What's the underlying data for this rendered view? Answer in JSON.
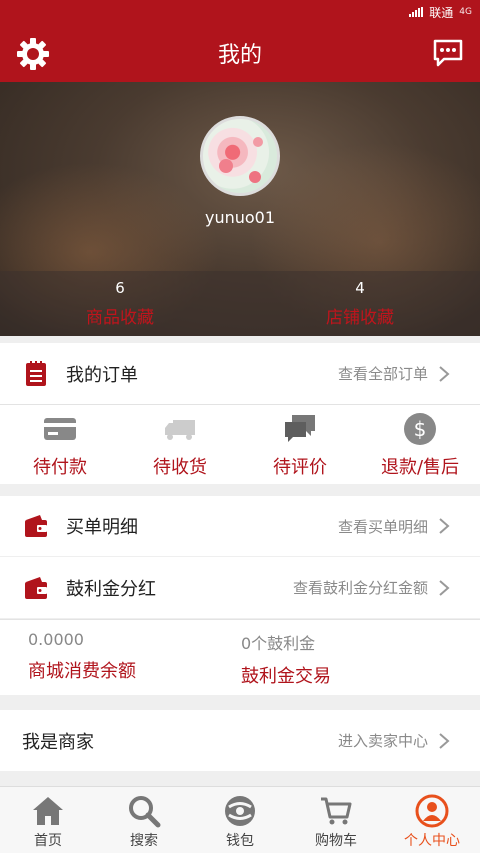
{
  "status_bar": {
    "carrier": "联通",
    "network": "4G"
  },
  "header": {
    "title": "我的",
    "settings_icon": "gear-icon",
    "message_icon": "chat-bubble-icon"
  },
  "profile": {
    "username": "yunuo01",
    "favorites": [
      {
        "count": "6",
        "label": "商品收藏"
      },
      {
        "count": "4",
        "label": "店铺收藏"
      }
    ]
  },
  "my_orders": {
    "title": "我的订单",
    "link": "查看全部订单"
  },
  "order_status": [
    {
      "label": "待付款",
      "icon": "credit-card-icon"
    },
    {
      "label": "待收货",
      "icon": "delivery-truck-icon"
    },
    {
      "label": "待评价",
      "icon": "comments-icon"
    },
    {
      "label": "退款/售后",
      "icon": "dollar-coin-icon"
    }
  ],
  "bill_details": {
    "title": "买单明细",
    "link": "查看买单明细"
  },
  "bonus": {
    "title": "鼓利金分红",
    "link": "查看鼓利金分红金额"
  },
  "balances": [
    {
      "value": "0.0000",
      "label": "商城消费余额"
    },
    {
      "value": "0个鼓利金",
      "label": "鼓利金交易"
    }
  ],
  "merchant": {
    "title": "我是商家",
    "link": "进入卖家中心"
  },
  "tabs": [
    {
      "label": "首页",
      "icon": "home-icon"
    },
    {
      "label": "搜索",
      "icon": "search-icon"
    },
    {
      "label": "钱包",
      "icon": "wallet-icon"
    },
    {
      "label": "购物车",
      "icon": "cart-icon"
    },
    {
      "label": "个人中心",
      "icon": "user-icon",
      "active": true
    }
  ],
  "colors": {
    "brand": "#b0141c",
    "active_tab": "#e8501c"
  }
}
